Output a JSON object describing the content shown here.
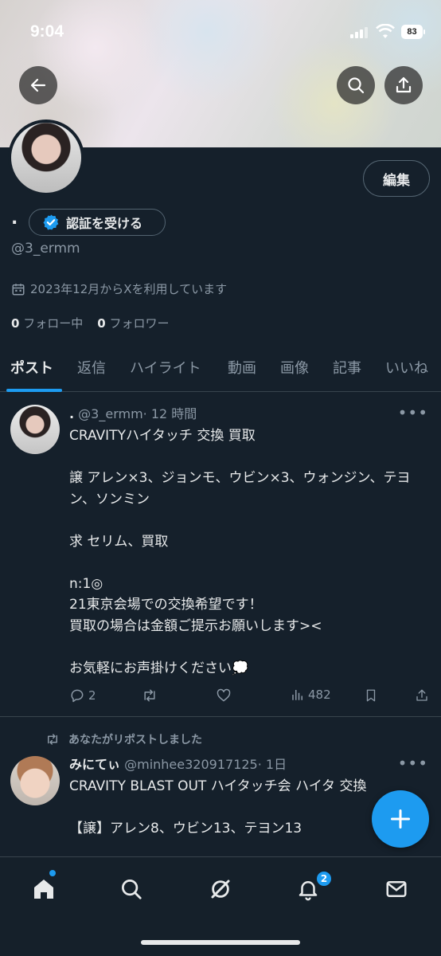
{
  "status_bar": {
    "time": "9:04",
    "battery": "83"
  },
  "profile": {
    "edit_label": "編集",
    "name": ".",
    "verify_label": "認証を受ける",
    "handle": "@3_ermm",
    "joined": "2023年12月からXを利用しています",
    "following_count": "0",
    "following_label": "フォロー中",
    "followers_count": "0",
    "followers_label": "フォロワー"
  },
  "tabs": [
    {
      "label": "ポスト"
    },
    {
      "label": "返信"
    },
    {
      "label": "ハイライト"
    },
    {
      "label": "動画"
    },
    {
      "label": "画像"
    },
    {
      "label": "記事"
    },
    {
      "label": "いいね"
    }
  ],
  "posts": [
    {
      "name": ".",
      "handle": "@3_ermm",
      "time": "· 12 時間",
      "text": "CRAVITYハイタッチ 交換 買取\n\n譲 アレン×3、ジョンモ、ウビン×3、ウォンジン、テヨン、ソンミン\n\n求 セリム、買取\n\nn:1◎\n21東京会場での交換希望です！\n買取の場合は金額ご提示お願いします><\n\nお気軽にお声掛けください💭",
      "replies": "2",
      "views": "482"
    },
    {
      "repost_label": "あなたがリポストしました",
      "name": "みにてぃ",
      "handle": "@minhee320917125",
      "time": "· 1日",
      "text": "CRAVITY BLAST OUT ハイタッチ会 ハイタ 交換\n\n【譲】アレン8、ウビン13、テヨン13"
    }
  ],
  "nav": {
    "notifications_badge": "2"
  },
  "colors": {
    "accent": "#1d9bf0",
    "background": "#15202b"
  }
}
